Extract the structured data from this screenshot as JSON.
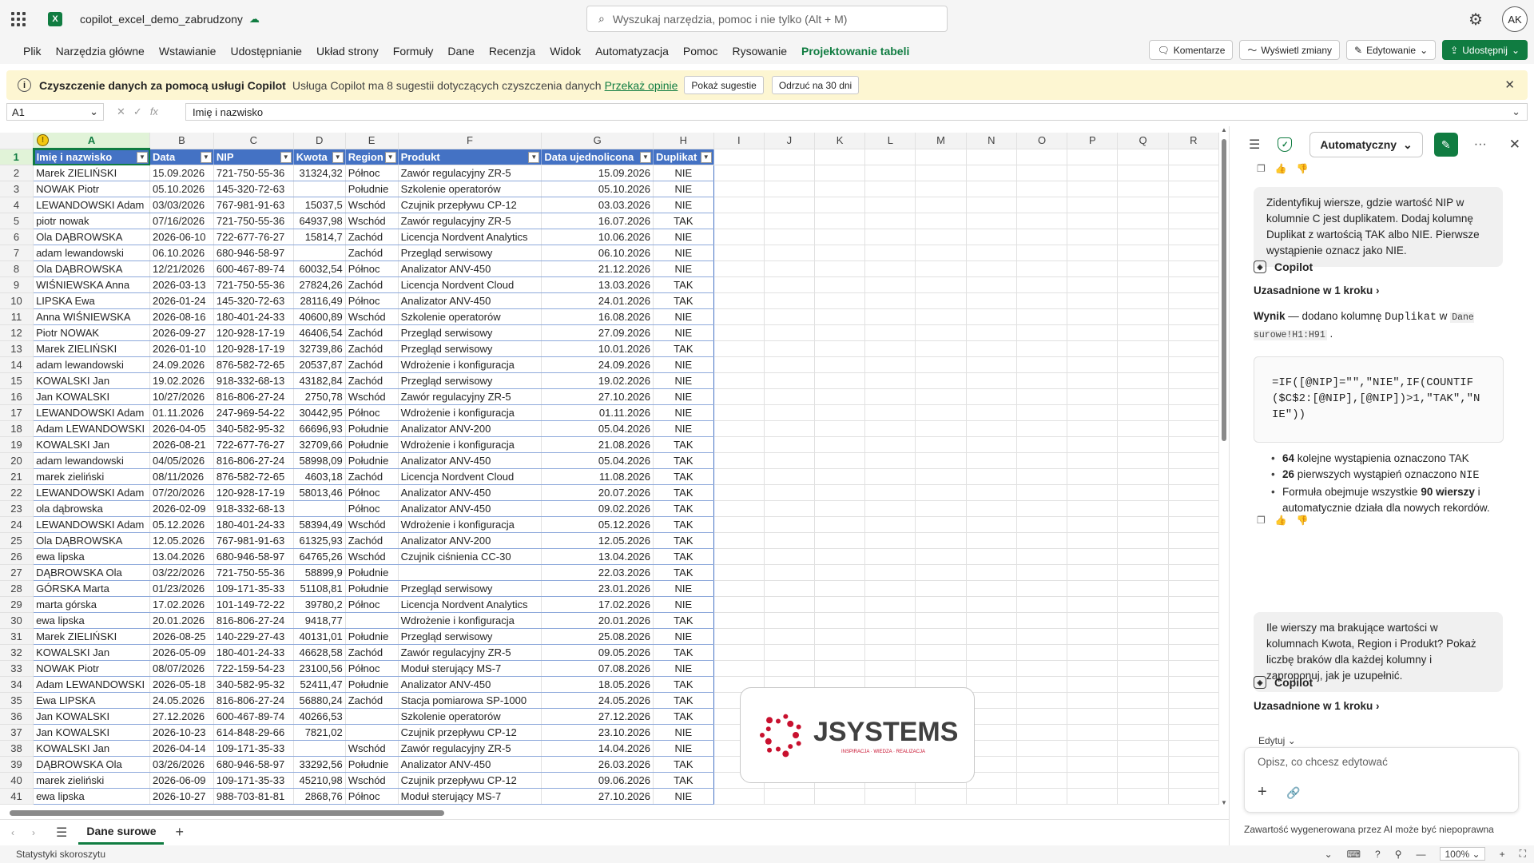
{
  "app": {
    "doc_title": "copilot_excel_demo_zabrudzony",
    "search_placeholder": "Wyszukaj narzędzia, pomoc i nie tylko (Alt + M)",
    "avatar": "AK"
  },
  "menu": {
    "tabs": [
      "Plik",
      "Narzędzia główne",
      "Wstawianie",
      "Udostępnianie",
      "Układ strony",
      "Formuły",
      "Dane",
      "Recenzja",
      "Widok",
      "Automatyzacja",
      "Pomoc",
      "Rysowanie",
      "Projektowanie tabeli"
    ],
    "active_tab": "Projektowanie tabeli",
    "comments": "Komentarze",
    "show_changes": "Wyświetl zmiany",
    "editing": "Edytowanie",
    "share": "Udostępnij"
  },
  "notice": {
    "title": "Czyszczenie danych za pomocą usługi Copilot",
    "desc": "Usługa Copilot ma 8 sugestii dotyczących czyszczenia danych",
    "link": "Przekaż opinie",
    "show": "Pokaż sugestie",
    "dismiss": "Odrzuć na 30 dni"
  },
  "formula_bar": {
    "name_box": "A1",
    "content": "Imię i nazwisko"
  },
  "grid": {
    "col_letters": [
      "A",
      "B",
      "C",
      "D",
      "E",
      "F",
      "G",
      "H",
      "I",
      "J",
      "K",
      "L",
      "M",
      "N",
      "O",
      "P",
      "Q",
      "R"
    ],
    "headers": [
      "Imię i nazwisko",
      "Data",
      "NIP",
      "Kwota",
      "Region",
      "Produkt",
      "Data ujednolicona",
      "Duplikat"
    ],
    "rows": [
      [
        "Marek ZIELIŃSKI",
        "15.09.2026",
        "721-750-55-36",
        "31324,32",
        "Północ",
        "Zawór regulacyjny ZR-5",
        "15.09.2026",
        "NIE"
      ],
      [
        "NOWAK Piotr",
        "05.10.2026",
        "145-320-72-63",
        "",
        "Południe",
        "Szkolenie operatorów",
        "05.10.2026",
        "NIE"
      ],
      [
        "LEWANDOWSKI Adam",
        "03/03/2026",
        "767-981-91-63",
        "15037,5",
        "Wschód",
        "Czujnik przepływu CP-12",
        "03.03.2026",
        "NIE"
      ],
      [
        "piotr nowak",
        "07/16/2026",
        "721-750-55-36",
        "64937,98",
        "Wschód",
        "Zawór regulacyjny ZR-5",
        "16.07.2026",
        "TAK"
      ],
      [
        "Ola DĄBROWSKA",
        "2026-06-10",
        "722-677-76-27",
        "15814,7",
        "Zachód",
        "Licencja Nordvent Analytics",
        "10.06.2026",
        "NIE"
      ],
      [
        "adam lewandowski",
        "06.10.2026",
        "680-946-58-97",
        "",
        "Zachód",
        "Przegląd serwisowy",
        "06.10.2026",
        "NIE"
      ],
      [
        "Ola DĄBROWSKA",
        "12/21/2026",
        "600-467-89-74",
        "60032,54",
        "Północ",
        "Analizator ANV-450",
        "21.12.2026",
        "NIE"
      ],
      [
        "WIŚNIEWSKA Anna",
        "2026-03-13",
        "721-750-55-36",
        "27824,26",
        "Zachód",
        "Licencja Nordvent Cloud",
        "13.03.2026",
        "TAK"
      ],
      [
        "LIPSKA Ewa",
        "2026-01-24",
        "145-320-72-63",
        "28116,49",
        "Północ",
        "Analizator ANV-450",
        "24.01.2026",
        "TAK"
      ],
      [
        "Anna WIŚNIEWSKA",
        "2026-08-16",
        "180-401-24-33",
        "40600,89",
        "Wschód",
        "Szkolenie operatorów",
        "16.08.2026",
        "NIE"
      ],
      [
        "Piotr NOWAK",
        "2026-09-27",
        "120-928-17-19",
        "46406,54",
        "Zachód",
        "Przegląd serwisowy",
        "27.09.2026",
        "NIE"
      ],
      [
        "Marek ZIELIŃSKI",
        "2026-01-10",
        "120-928-17-19",
        "32739,86",
        "Zachód",
        "Przegląd serwisowy",
        "10.01.2026",
        "TAK"
      ],
      [
        "adam lewandowski",
        "24.09.2026",
        "876-582-72-65",
        "20537,87",
        "Zachód",
        "Wdrożenie i konfiguracja",
        "24.09.2026",
        "NIE"
      ],
      [
        "KOWALSKI Jan",
        "19.02.2026",
        "918-332-68-13",
        "43182,84",
        "Zachód",
        "Przegląd serwisowy",
        "19.02.2026",
        "NIE"
      ],
      [
        "Jan KOWALSKI",
        "10/27/2026",
        "816-806-27-24",
        "2750,78",
        "Wschód",
        "Zawór regulacyjny ZR-5",
        "27.10.2026",
        "NIE"
      ],
      [
        "LEWANDOWSKI Adam",
        "01.11.2026",
        "247-969-54-22",
        "30442,95",
        "Północ",
        "Wdrożenie i konfiguracja",
        "01.11.2026",
        "NIE"
      ],
      [
        "Adam LEWANDOWSKI",
        "2026-04-05",
        "340-582-95-32",
        "66696,93",
        "Południe",
        "Analizator ANV-200",
        "05.04.2026",
        "NIE"
      ],
      [
        "KOWALSKI Jan",
        "2026-08-21",
        "722-677-76-27",
        "32709,66",
        "Południe",
        "Wdrożenie i konfiguracja",
        "21.08.2026",
        "TAK"
      ],
      [
        "adam lewandowski",
        "04/05/2026",
        "816-806-27-24",
        "58998,09",
        "Południe",
        "Analizator ANV-450",
        "05.04.2026",
        "TAK"
      ],
      [
        "marek zieliński",
        "08/11/2026",
        "876-582-72-65",
        "4603,18",
        "Zachód",
        "Licencja Nordvent Cloud",
        "11.08.2026",
        "TAK"
      ],
      [
        "LEWANDOWSKI Adam",
        "07/20/2026",
        "120-928-17-19",
        "58013,46",
        "Północ",
        "Analizator ANV-450",
        "20.07.2026",
        "TAK"
      ],
      [
        "ola dąbrowska",
        "2026-02-09",
        "918-332-68-13",
        "",
        "Północ",
        "Analizator ANV-450",
        "09.02.2026",
        "TAK"
      ],
      [
        "LEWANDOWSKI Adam",
        "05.12.2026",
        "180-401-24-33",
        "58394,49",
        "Wschód",
        "Wdrożenie i konfiguracja",
        "05.12.2026",
        "TAK"
      ],
      [
        "Ola DĄBROWSKA",
        "12.05.2026",
        "767-981-91-63",
        "61325,93",
        "Zachód",
        "Analizator ANV-200",
        "12.05.2026",
        "TAK"
      ],
      [
        "ewa lipska",
        "13.04.2026",
        "680-946-58-97",
        "64765,26",
        "Wschód",
        "Czujnik ciśnienia CC-30",
        "13.04.2026",
        "TAK"
      ],
      [
        "DĄBROWSKA Ola",
        "03/22/2026",
        "721-750-55-36",
        "58899,9",
        "Południe",
        "",
        "22.03.2026",
        "TAK"
      ],
      [
        "GÓRSKA Marta",
        "01/23/2026",
        "109-171-35-33",
        "51108,81",
        "Południe",
        "Przegląd serwisowy",
        "23.01.2026",
        "NIE"
      ],
      [
        "marta górska",
        "17.02.2026",
        "101-149-72-22",
        "39780,2",
        "Północ",
        "Licencja Nordvent Analytics",
        "17.02.2026",
        "NIE"
      ],
      [
        "ewa lipska",
        "20.01.2026",
        "816-806-27-24",
        "9418,77",
        "",
        "Wdrożenie i konfiguracja",
        "20.01.2026",
        "TAK"
      ],
      [
        "Marek ZIELIŃSKI",
        "2026-08-25",
        "140-229-27-43",
        "40131,01",
        "Południe",
        "Przegląd serwisowy",
        "25.08.2026",
        "NIE"
      ],
      [
        "KOWALSKI Jan",
        "2026-05-09",
        "180-401-24-33",
        "46628,58",
        "Zachód",
        "Zawór regulacyjny ZR-5",
        "09.05.2026",
        "TAK"
      ],
      [
        "NOWAK Piotr",
        "08/07/2026",
        "722-159-54-23",
        "23100,56",
        "Północ",
        "Moduł sterujący MS-7",
        "07.08.2026",
        "NIE"
      ],
      [
        "Adam LEWANDOWSKI",
        "2026-05-18",
        "340-582-95-32",
        "52411,47",
        "Południe",
        "Analizator ANV-450",
        "18.05.2026",
        "TAK"
      ],
      [
        "Ewa LIPSKA",
        "24.05.2026",
        "816-806-27-24",
        "56880,24",
        "Zachód",
        "Stacja pomiarowa SP-1000",
        "24.05.2026",
        "TAK"
      ],
      [
        "Jan KOWALSKI",
        "27.12.2026",
        "600-467-89-74",
        "40266,53",
        "",
        "Szkolenie operatorów",
        "27.12.2026",
        "TAK"
      ],
      [
        "Jan KOWALSKI",
        "2026-10-23",
        "614-848-29-66",
        "7821,02",
        "",
        "Czujnik przepływu CP-12",
        "23.10.2026",
        "NIE"
      ],
      [
        "KOWALSKI Jan",
        "2026-04-14",
        "109-171-35-33",
        "",
        "Wschód",
        "Zawór regulacyjny ZR-5",
        "14.04.2026",
        "NIE"
      ],
      [
        "DĄBROWSKA Ola",
        "03/26/2026",
        "680-946-58-97",
        "33292,56",
        "Południe",
        "Analizator ANV-450",
        "26.03.2026",
        "TAK"
      ],
      [
        "marek zieliński",
        "2026-06-09",
        "109-171-35-33",
        "45210,98",
        "Wschód",
        "Czujnik przepływu CP-12",
        "09.06.2026",
        "TAK"
      ],
      [
        "ewa lipska",
        "2026-10-27",
        "988-703-81-81",
        "2868,76",
        "Północ",
        "Moduł sterujący MS-7",
        "27.10.2026",
        "NIE"
      ]
    ]
  },
  "sheet": {
    "tab": "Dane surowe"
  },
  "logo": {
    "brand": "JSYSTEMS",
    "tagline": "INSPIRACJA · WIEDZA · REALIZACJA",
    "color": "#c8102e"
  },
  "status": {
    "left": "Statystyki skoroszytu",
    "zoom": "100%"
  },
  "copilot": {
    "mode": "Automatyczny",
    "msg1": "Zidentyfikuj wiersze, gdzie wartość NIP w kolumnie C jest duplikatem. Dodaj kolumnę Duplikat z wartością TAK albo NIE. Pierwsze wystąpienie oznacz jako NIE.",
    "label": "Copilot",
    "grounded": "Uzasadnione w 1 kroku",
    "result_prefix": "Wynik",
    "result_mid": " — dodano kolumnę ",
    "result_col": "Duplikat",
    "result_in": " w ",
    "result_ref": "Dane surowe!H1:H91",
    "result_end": " .",
    "formula": "=IF([@NIP]=\"\",\"NIE\",IF(COUNTIF($C$2:[@NIP],[@NIP])>1,\"TAK\",\"NIE\"))",
    "b1_num": "64",
    "b1_txt": " kolejne wystąpienia oznaczono TAK",
    "b2_num": "26",
    "b2_txt": " pierwszych wystąpień oznaczono ",
    "b2_code": "NIE",
    "b3_pre": "Formuła obejmuje wszystkie ",
    "b3_num": "90 wierszy",
    "b3_post": " i automatycznie działa dla nowych rekordów.",
    "msg2": "Ile wierszy ma brakujące wartości w kolumnach Kwota, Region i Produkt? Pokaż liczbę braków dla każdej kolumny i zaproponuj, jak je uzupełnić.",
    "grounded2": "Uzasadnione w 1 kroku",
    "edit_label": "Edytuj",
    "input_placeholder": "Opisz, co chcesz edytować",
    "disclaimer": "Zawartość wygenerowana przez AI może być niepoprawna"
  }
}
